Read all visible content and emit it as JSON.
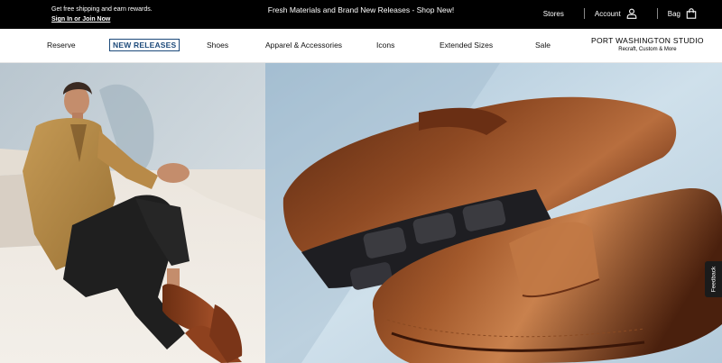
{
  "topbar": {
    "promo_line1": "Get free shipping and earn rewards.",
    "promo_line2": "Sign In or Join Now",
    "center_message": "Fresh Materials and Brand New Releases - Shop New!",
    "stores_label": "Stores",
    "account_label": "Account",
    "bag_label": "Bag",
    "account_icon": "user-icon",
    "bag_icon": "shopping-bag-icon"
  },
  "nav": {
    "items": [
      {
        "label": "Reserve"
      },
      {
        "label": "NEW RELEASES",
        "active": true
      },
      {
        "label": "Shoes"
      },
      {
        "label": "Apparel & Accessories"
      },
      {
        "label": "Icons"
      },
      {
        "label": "Extended Sizes"
      },
      {
        "label": "Sale"
      }
    ],
    "studio_title": "PORT WASHINGTON STUDIO",
    "studio_subtitle": "Recraft, Custom & More",
    "active_color": "#1d4a7a"
  },
  "feedback": {
    "label": "Feedback"
  }
}
